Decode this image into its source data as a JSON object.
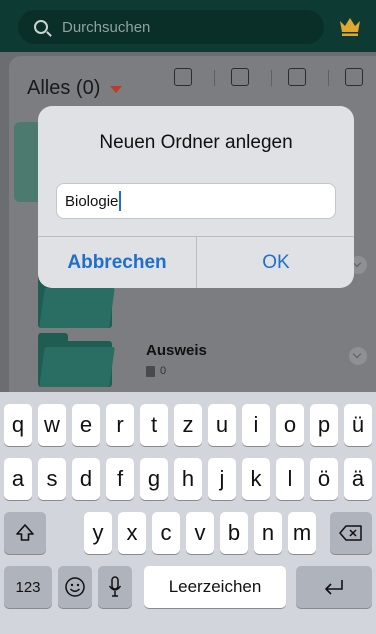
{
  "search": {
    "placeholder": "Durchsuchen"
  },
  "toolbar": {
    "filter_label": "Alles (0)"
  },
  "folders": [
    {
      "title": "Ausweis",
      "count": "0"
    }
  ],
  "dialog": {
    "title": "Neuen Ordner anlegen",
    "input_value": "Biologie",
    "cancel_label": "Abbrechen",
    "ok_label": "OK"
  },
  "keyboard": {
    "row1": [
      "q",
      "w",
      "e",
      "r",
      "t",
      "z",
      "u",
      "i",
      "o",
      "p",
      "ü"
    ],
    "row2": [
      "a",
      "s",
      "d",
      "f",
      "g",
      "h",
      "j",
      "k",
      "l",
      "ö",
      "ä"
    ],
    "row3": [
      "y",
      "x",
      "c",
      "v",
      "b",
      "n",
      "m"
    ],
    "numbers_label": "123",
    "space_label": "Leerzeichen",
    "icons": [
      "shift-icon",
      "backspace-icon",
      "emoji-icon",
      "microphone-icon",
      "return-icon"
    ]
  },
  "colors": {
    "header_bg": "#0d3a33",
    "accent_blue": "#1e6fcf",
    "caret_red": "#c0392b",
    "crown_gold": "#e0a82e"
  }
}
